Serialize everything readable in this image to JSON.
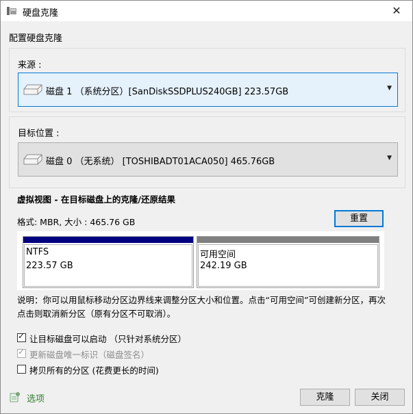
{
  "window": {
    "title": "硬盘克隆",
    "close_glyph": "✕"
  },
  "header": {
    "section_title": "配置硬盘克隆"
  },
  "source": {
    "label": "来源 :",
    "value": "磁盘 1 （系统分区）[SanDiskSSDPLUS240GB]  223.57GB"
  },
  "target": {
    "label": "目标位置 :",
    "value": "磁盘 0 （无系统） [TOSHIBADT01ACA050]  465.76GB"
  },
  "virtual_view": {
    "title": "虚拟视图 - 在目标磁盘上的克隆/还原结果",
    "format_text": "格式:   MBR,  大小 :   465.76 GB",
    "reset_label": "重置",
    "partitions": [
      {
        "name": "NTFS",
        "size": "223.57 GB",
        "color": "#000080"
      },
      {
        "name": "可用空间",
        "size": "242.19 GB",
        "color": "#808080"
      }
    ]
  },
  "note": "说明：你可以用鼠标移动分区边界线来调整分区大小和位置。点击“可用空间”可创建新分区，再次点击则取消新分区（原有分区不可取消）。",
  "checkboxes": [
    {
      "label": "让目标磁盘可以启动  （只针对系统分区）",
      "checked": true,
      "disabled": false
    },
    {
      "label": "更新磁盘唯一标识（磁盘签名）",
      "checked": true,
      "disabled": true
    },
    {
      "label": "拷贝所有的分区 (花费更长的时间)",
      "checked": false,
      "disabled": false
    }
  ],
  "footer": {
    "options_label": "选项",
    "clone_label": "克隆",
    "close_label": "关闭"
  },
  "colors": {
    "accent": "#0078d7",
    "ntfs": "#000080",
    "free": "#808080",
    "options_text": "#2f7f2f"
  }
}
